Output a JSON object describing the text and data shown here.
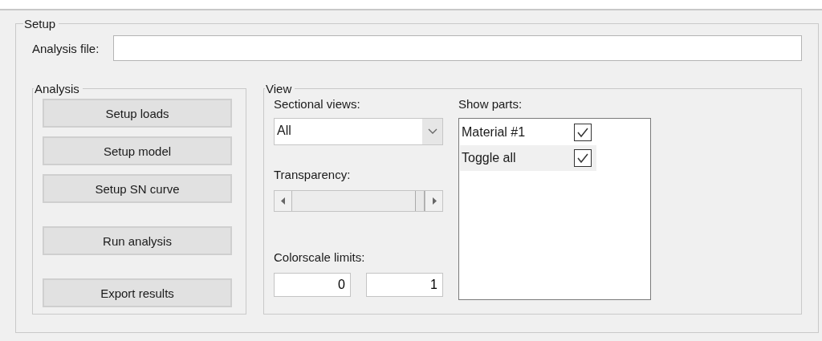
{
  "setup": {
    "title": "Setup",
    "analysis_file": {
      "label": "Analysis file:"
    }
  },
  "analysis": {
    "title": "Analysis",
    "button_groups": [
      [
        "Setup loads",
        "Setup model",
        "Setup SN curve"
      ],
      [
        "Run analysis"
      ],
      [
        "Export results"
      ]
    ]
  },
  "view": {
    "title": "View",
    "sectional_views": {
      "label": "Sectional views:",
      "value": "All"
    },
    "transparency": {
      "label": "Transparency:",
      "level": 1
    },
    "colorscale_limits": {
      "label": "Colorscale limits:",
      "min": "0",
      "max": "1"
    },
    "show_parts": {
      "label": "Show parts:",
      "items": [
        {
          "label": "Material #1",
          "checked": true,
          "selected": false
        },
        {
          "label": "Toggle all",
          "checked": true,
          "selected": true
        }
      ]
    }
  }
}
